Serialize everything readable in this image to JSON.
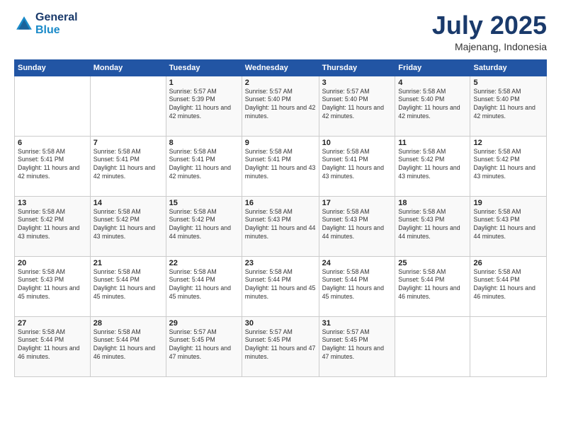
{
  "logo": {
    "line1": "General",
    "line2": "Blue"
  },
  "title": "July 2025",
  "location": "Majenang, Indonesia",
  "days_of_week": [
    "Sunday",
    "Monday",
    "Tuesday",
    "Wednesday",
    "Thursday",
    "Friday",
    "Saturday"
  ],
  "weeks": [
    [
      {
        "day": "",
        "info": ""
      },
      {
        "day": "",
        "info": ""
      },
      {
        "day": "1",
        "info": "Sunrise: 5:57 AM\nSunset: 5:39 PM\nDaylight: 11 hours and 42 minutes."
      },
      {
        "day": "2",
        "info": "Sunrise: 5:57 AM\nSunset: 5:40 PM\nDaylight: 11 hours and 42 minutes."
      },
      {
        "day": "3",
        "info": "Sunrise: 5:57 AM\nSunset: 5:40 PM\nDaylight: 11 hours and 42 minutes."
      },
      {
        "day": "4",
        "info": "Sunrise: 5:58 AM\nSunset: 5:40 PM\nDaylight: 11 hours and 42 minutes."
      },
      {
        "day": "5",
        "info": "Sunrise: 5:58 AM\nSunset: 5:40 PM\nDaylight: 11 hours and 42 minutes."
      }
    ],
    [
      {
        "day": "6",
        "info": "Sunrise: 5:58 AM\nSunset: 5:41 PM\nDaylight: 11 hours and 42 minutes."
      },
      {
        "day": "7",
        "info": "Sunrise: 5:58 AM\nSunset: 5:41 PM\nDaylight: 11 hours and 42 minutes."
      },
      {
        "day": "8",
        "info": "Sunrise: 5:58 AM\nSunset: 5:41 PM\nDaylight: 11 hours and 42 minutes."
      },
      {
        "day": "9",
        "info": "Sunrise: 5:58 AM\nSunset: 5:41 PM\nDaylight: 11 hours and 43 minutes."
      },
      {
        "day": "10",
        "info": "Sunrise: 5:58 AM\nSunset: 5:41 PM\nDaylight: 11 hours and 43 minutes."
      },
      {
        "day": "11",
        "info": "Sunrise: 5:58 AM\nSunset: 5:42 PM\nDaylight: 11 hours and 43 minutes."
      },
      {
        "day": "12",
        "info": "Sunrise: 5:58 AM\nSunset: 5:42 PM\nDaylight: 11 hours and 43 minutes."
      }
    ],
    [
      {
        "day": "13",
        "info": "Sunrise: 5:58 AM\nSunset: 5:42 PM\nDaylight: 11 hours and 43 minutes."
      },
      {
        "day": "14",
        "info": "Sunrise: 5:58 AM\nSunset: 5:42 PM\nDaylight: 11 hours and 43 minutes."
      },
      {
        "day": "15",
        "info": "Sunrise: 5:58 AM\nSunset: 5:42 PM\nDaylight: 11 hours and 44 minutes."
      },
      {
        "day": "16",
        "info": "Sunrise: 5:58 AM\nSunset: 5:43 PM\nDaylight: 11 hours and 44 minutes."
      },
      {
        "day": "17",
        "info": "Sunrise: 5:58 AM\nSunset: 5:43 PM\nDaylight: 11 hours and 44 minutes."
      },
      {
        "day": "18",
        "info": "Sunrise: 5:58 AM\nSunset: 5:43 PM\nDaylight: 11 hours and 44 minutes."
      },
      {
        "day": "19",
        "info": "Sunrise: 5:58 AM\nSunset: 5:43 PM\nDaylight: 11 hours and 44 minutes."
      }
    ],
    [
      {
        "day": "20",
        "info": "Sunrise: 5:58 AM\nSunset: 5:43 PM\nDaylight: 11 hours and 45 minutes."
      },
      {
        "day": "21",
        "info": "Sunrise: 5:58 AM\nSunset: 5:44 PM\nDaylight: 11 hours and 45 minutes."
      },
      {
        "day": "22",
        "info": "Sunrise: 5:58 AM\nSunset: 5:44 PM\nDaylight: 11 hours and 45 minutes."
      },
      {
        "day": "23",
        "info": "Sunrise: 5:58 AM\nSunset: 5:44 PM\nDaylight: 11 hours and 45 minutes."
      },
      {
        "day": "24",
        "info": "Sunrise: 5:58 AM\nSunset: 5:44 PM\nDaylight: 11 hours and 45 minutes."
      },
      {
        "day": "25",
        "info": "Sunrise: 5:58 AM\nSunset: 5:44 PM\nDaylight: 11 hours and 46 minutes."
      },
      {
        "day": "26",
        "info": "Sunrise: 5:58 AM\nSunset: 5:44 PM\nDaylight: 11 hours and 46 minutes."
      }
    ],
    [
      {
        "day": "27",
        "info": "Sunrise: 5:58 AM\nSunset: 5:44 PM\nDaylight: 11 hours and 46 minutes."
      },
      {
        "day": "28",
        "info": "Sunrise: 5:58 AM\nSunset: 5:44 PM\nDaylight: 11 hours and 46 minutes."
      },
      {
        "day": "29",
        "info": "Sunrise: 5:57 AM\nSunset: 5:45 PM\nDaylight: 11 hours and 47 minutes."
      },
      {
        "day": "30",
        "info": "Sunrise: 5:57 AM\nSunset: 5:45 PM\nDaylight: 11 hours and 47 minutes."
      },
      {
        "day": "31",
        "info": "Sunrise: 5:57 AM\nSunset: 5:45 PM\nDaylight: 11 hours and 47 minutes."
      },
      {
        "day": "",
        "info": ""
      },
      {
        "day": "",
        "info": ""
      }
    ]
  ]
}
